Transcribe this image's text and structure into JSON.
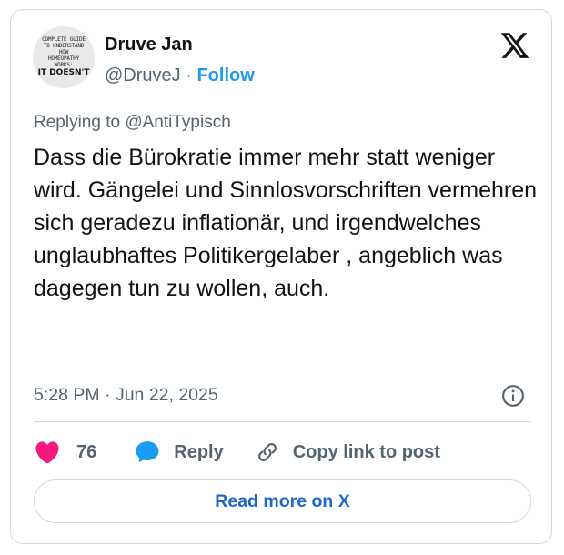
{
  "author": {
    "name": "Druve Jan",
    "handle": "@DruveJ",
    "separator": "·",
    "follow_label": "Follow"
  },
  "avatar": {
    "lines": [
      "COMPLETE GUIDE",
      "TO UNDERSTAND",
      "HOW",
      "HOMEOPATHY",
      "WORKS:",
      "IT DOESN'T"
    ]
  },
  "post": {
    "reply_prefix": "Replying to ",
    "reply_to": "@AntiTypisch",
    "text": "Dass die Bürokratie immer mehr statt weniger wird. Gängelei und Sinnlosvorschriften vermehren sich geradezu inflationär, und irgendwelches unglaubhaftes Politikergelaber , angeblich was dagegen tun zu wollen, auch.",
    "timestamp": "5:28 PM · Jun 22, 2025"
  },
  "actions": {
    "like_count": "76",
    "reply_label": "Reply",
    "copy_label": "Copy link to post"
  },
  "read_more_label": "Read more on X",
  "colors": {
    "accent": "#1d9bf0",
    "like": "#f91880",
    "muted": "#536471",
    "border": "#cfd9de"
  },
  "icons": [
    "x-logo-icon",
    "info-icon",
    "heart-icon",
    "reply-bubble-icon",
    "link-icon"
  ]
}
